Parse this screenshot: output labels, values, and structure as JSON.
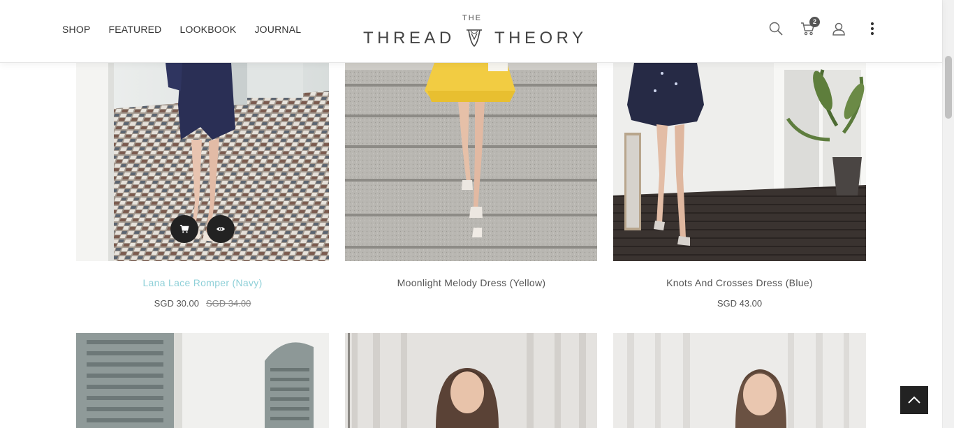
{
  "nav": {
    "items": [
      {
        "label": "SHOP"
      },
      {
        "label": "FEATURED"
      },
      {
        "label": "LOOKBOOK"
      },
      {
        "label": "JOURNAL"
      }
    ]
  },
  "logo": {
    "top_text": "THE",
    "left_word": "THREAD",
    "right_word": "THEORY"
  },
  "header": {
    "cart_count": "2"
  },
  "products": [
    {
      "name": "Lana Lace Romper (Navy)",
      "price": "SGD 30.00",
      "old_price": "SGD 34.00"
    },
    {
      "name": "Moonlight Melody Dress (Yellow)",
      "price": "",
      "old_price": ""
    },
    {
      "name": "Knots And Crosses Dress (Blue)",
      "price": "SGD 43.00",
      "old_price": ""
    }
  ],
  "colors": {
    "accent_active": "#8fd0d8",
    "button_dark": "#222222"
  }
}
